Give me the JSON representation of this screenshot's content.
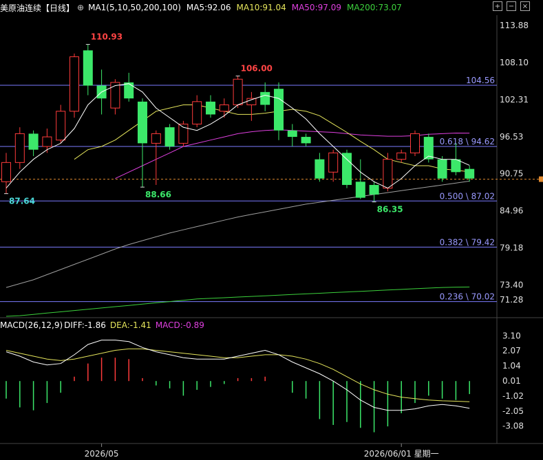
{
  "header": {
    "instrument": "美原油连续",
    "period": "【日线】",
    "ma_label": "MA1(5,10,50,200,100)",
    "ma5": "MA5:92.06",
    "ma10": "MA10:91.04",
    "ma50": "MA50:97.09",
    "ma200": "MA200:73.07"
  },
  "colors": {
    "up": "#ff3b3b",
    "down": "#3ce86a",
    "ma5": "#ffffff",
    "ma10": "#e6e65c",
    "ma50": "#e040e0",
    "ma200": "#3cd23c",
    "ma100": "#a0a0a0",
    "fib": "#7b7bff"
  },
  "toolbar": {
    "icons": [
      "zoom-in-icon",
      "zoom-out-icon",
      "close-icon"
    ]
  },
  "chart_data": {
    "type": "candlestick",
    "price_ticks": [
      "113.88",
      "108.10",
      "102.31",
      "96.53",
      "90.75",
      "84.96",
      "79.18",
      "73.40"
    ],
    "price_range": [
      68.5,
      115.5
    ],
    "current_price": "71.28",
    "dashed_level": 89.9,
    "x_labels": [
      "2026/05",
      "2026/06/01 星期一"
    ],
    "x_label_index": [
      7,
      29
    ],
    "fib_levels": [
      {
        "price": 104.56,
        "label": "104.56"
      },
      {
        "price": 95.0,
        "label": "0.618 \\ 94.62"
      },
      {
        "price": 86.5,
        "label": "0.500 \\ 87.02"
      },
      {
        "price": 79.3,
        "label": "0.382 \\ 79.42"
      },
      {
        "price": 70.8,
        "label": "0.236 \\ 70.02"
      }
    ],
    "annotations": [
      {
        "index": 6,
        "price": 110.93,
        "label": "110.93",
        "color": "#ff4444",
        "pos": "top"
      },
      {
        "index": 17,
        "price": 106.0,
        "label": "106.00",
        "color": "#ff4444",
        "pos": "top"
      },
      {
        "index": 0,
        "price": 87.64,
        "label": "87.64",
        "color": "#4bd8d8",
        "pos": "bottom"
      },
      {
        "index": 10,
        "price": 88.66,
        "label": "88.66",
        "color": "#3ce86a",
        "pos": "bottom"
      },
      {
        "index": 27,
        "price": 86.35,
        "label": "86.35",
        "color": "#3ce86a",
        "pos": "bottom"
      }
    ],
    "candles": [
      {
        "o": 89.5,
        "h": 94.0,
        "l": 87.64,
        "c": 92.5
      },
      {
        "o": 92.5,
        "h": 98.0,
        "l": 91.5,
        "c": 97.0
      },
      {
        "o": 97.0,
        "h": 97.5,
        "l": 93.5,
        "c": 94.5
      },
      {
        "o": 95.0,
        "h": 97.8,
        "l": 94.0,
        "c": 96.5
      },
      {
        "o": 96.0,
        "h": 101.5,
        "l": 95.5,
        "c": 100.5
      },
      {
        "o": 100.5,
        "h": 109.5,
        "l": 99.5,
        "c": 109.0
      },
      {
        "o": 110.0,
        "h": 110.93,
        "l": 103.0,
        "c": 104.5
      },
      {
        "o": 104.5,
        "h": 107.0,
        "l": 100.0,
        "c": 102.5
      },
      {
        "o": 101.0,
        "h": 105.5,
        "l": 100.0,
        "c": 105.0
      },
      {
        "o": 105.0,
        "h": 106.5,
        "l": 102.0,
        "c": 102.5
      },
      {
        "o": 102.0,
        "h": 102.5,
        "l": 88.66,
        "c": 95.5
      },
      {
        "o": 95.5,
        "h": 97.5,
        "l": 89.0,
        "c": 97.0
      },
      {
        "o": 98.0,
        "h": 98.5,
        "l": 94.5,
        "c": 95.0
      },
      {
        "o": 95.5,
        "h": 99.0,
        "l": 95.0,
        "c": 98.5
      },
      {
        "o": 98.5,
        "h": 103.0,
        "l": 98.0,
        "c": 102.0
      },
      {
        "o": 102.0,
        "h": 103.0,
        "l": 99.5,
        "c": 100.0
      },
      {
        "o": 100.5,
        "h": 102.5,
        "l": 99.5,
        "c": 101.5
      },
      {
        "o": 101.5,
        "h": 106.0,
        "l": 101.0,
        "c": 105.5
      },
      {
        "o": 101.5,
        "h": 103.5,
        "l": 99.0,
        "c": 102.5
      },
      {
        "o": 103.5,
        "h": 105.0,
        "l": 100.5,
        "c": 101.5
      },
      {
        "o": 104.0,
        "h": 105.0,
        "l": 96.0,
        "c": 97.5
      },
      {
        "o": 97.5,
        "h": 98.5,
        "l": 95.0,
        "c": 96.5
      },
      {
        "o": 96.5,
        "h": 97.0,
        "l": 95.0,
        "c": 95.5
      },
      {
        "o": 93.0,
        "h": 94.0,
        "l": 89.5,
        "c": 90.0
      },
      {
        "o": 91.0,
        "h": 94.5,
        "l": 89.5,
        "c": 94.0
      },
      {
        "o": 94.0,
        "h": 94.5,
        "l": 88.5,
        "c": 89.0
      },
      {
        "o": 89.5,
        "h": 93.0,
        "l": 86.8,
        "c": 87.0
      },
      {
        "o": 89.0,
        "h": 89.5,
        "l": 86.35,
        "c": 87.5
      },
      {
        "o": 88.5,
        "h": 94.0,
        "l": 88.0,
        "c": 93.0
      },
      {
        "o": 93.0,
        "h": 94.5,
        "l": 92.5,
        "c": 94.0
      },
      {
        "o": 94.0,
        "h": 97.5,
        "l": 93.5,
        "c": 97.0
      },
      {
        "o": 96.5,
        "h": 97.0,
        "l": 92.5,
        "c": 93.0
      },
      {
        "o": 93.0,
        "h": 93.5,
        "l": 89.5,
        "c": 90.0
      },
      {
        "o": 93.0,
        "h": 95.5,
        "l": 90.5,
        "c": 91.0
      },
      {
        "o": 91.5,
        "h": 92.0,
        "l": 89.5,
        "c": 90.0
      }
    ],
    "ma5": [
      88.5,
      91.0,
      93.0,
      94.5,
      95.5,
      97.8,
      101.5,
      103.5,
      104.5,
      104.8,
      103.5,
      101.0,
      99.5,
      98.0,
      97.5,
      98.5,
      99.8,
      101.5,
      102.3,
      103.0,
      102.5,
      101.0,
      99.3,
      97.0,
      95.0,
      93.0,
      91.0,
      89.5,
      88.5,
      90.0,
      92.0,
      93.5,
      93.0,
      93.0,
      92.06
    ],
    "ma10": [
      null,
      null,
      null,
      null,
      null,
      93.0,
      94.5,
      95.0,
      96.0,
      97.5,
      99.0,
      100.5,
      101.0,
      101.5,
      101.5,
      101.0,
      100.5,
      100.0,
      100.0,
      100.2,
      100.5,
      100.8,
      100.5,
      99.8,
      98.5,
      97.2,
      95.8,
      94.5,
      93.0,
      92.5,
      92.0,
      92.0,
      91.5,
      91.3,
      91.04
    ],
    "ma50": [
      null,
      null,
      null,
      null,
      null,
      null,
      null,
      null,
      90.0,
      91.0,
      92.0,
      93.0,
      94.0,
      95.0,
      95.5,
      96.0,
      96.5,
      97.0,
      97.3,
      97.5,
      97.6,
      97.5,
      97.4,
      97.3,
      97.2,
      97.0,
      96.8,
      96.7,
      96.6,
      96.6,
      96.7,
      96.9,
      97.0,
      97.1,
      97.09
    ],
    "ma100": [
      73.0,
      73.6,
      74.2,
      75.0,
      75.8,
      76.6,
      77.4,
      78.2,
      79.0,
      79.7,
      80.3,
      80.9,
      81.5,
      82.0,
      82.5,
      83.0,
      83.5,
      84.0,
      84.4,
      84.8,
      85.2,
      85.6,
      86.0,
      86.3,
      86.6,
      86.9,
      87.2,
      87.5,
      87.8,
      88.1,
      88.4,
      88.7,
      89.0,
      89.3,
      89.6
    ],
    "ma200": [
      68.5,
      68.6,
      68.8,
      69.0,
      69.2,
      69.4,
      69.6,
      69.8,
      70.0,
      70.2,
      70.4,
      70.6,
      70.8,
      71.0,
      71.2,
      71.3,
      71.4,
      71.5,
      71.6,
      71.7,
      71.8,
      71.9,
      72.0,
      72.1,
      72.2,
      72.3,
      72.4,
      72.5,
      72.6,
      72.7,
      72.8,
      72.9,
      73.0,
      73.05,
      73.07
    ],
    "macd": {
      "label": "MACD(26,12,9)",
      "diff_label": "DIFF:-1.86",
      "dea_label": "DEA:-1.41",
      "macd_label": "MACD:-0.89",
      "ticks": [
        "3.10",
        "2.07",
        "1.04",
        "0.01",
        "-1.02",
        "-2.05",
        "-3.08"
      ],
      "range": [
        -3.8,
        3.3
      ],
      "diff": [
        2.0,
        1.7,
        1.3,
        1.1,
        1.2,
        1.8,
        2.5,
        2.8,
        2.8,
        2.7,
        2.3,
        2.0,
        1.8,
        1.6,
        1.5,
        1.5,
        1.5,
        1.7,
        1.9,
        2.1,
        1.8,
        1.3,
        0.9,
        0.5,
        0.0,
        -0.6,
        -1.3,
        -1.8,
        -2.0,
        -2.0,
        -1.9,
        -1.7,
        -1.6,
        -1.7,
        -1.86
      ],
      "dea": [
        2.1,
        1.9,
        1.7,
        1.5,
        1.4,
        1.5,
        1.7,
        1.9,
        2.1,
        2.2,
        2.2,
        2.1,
        2.0,
        1.9,
        1.8,
        1.7,
        1.6,
        1.6,
        1.7,
        1.8,
        1.8,
        1.7,
        1.5,
        1.2,
        0.8,
        0.3,
        -0.2,
        -0.6,
        -0.9,
        -1.1,
        -1.2,
        -1.3,
        -1.35,
        -1.38,
        -1.41
      ],
      "hist": [
        -1.2,
        -1.8,
        -2.0,
        -1.5,
        -0.8,
        0.3,
        1.2,
        1.6,
        1.6,
        1.5,
        0.2,
        -0.3,
        -0.5,
        -1.0,
        -0.6,
        -0.4,
        -0.2,
        0.2,
        0.2,
        0.3,
        0.0,
        -0.8,
        -1.2,
        -2.6,
        -3.0,
        -2.8,
        -3.2,
        -3.5,
        -3.1,
        -2.2,
        -1.5,
        -1.0,
        -1.2,
        -1.3,
        -0.89
      ]
    }
  }
}
